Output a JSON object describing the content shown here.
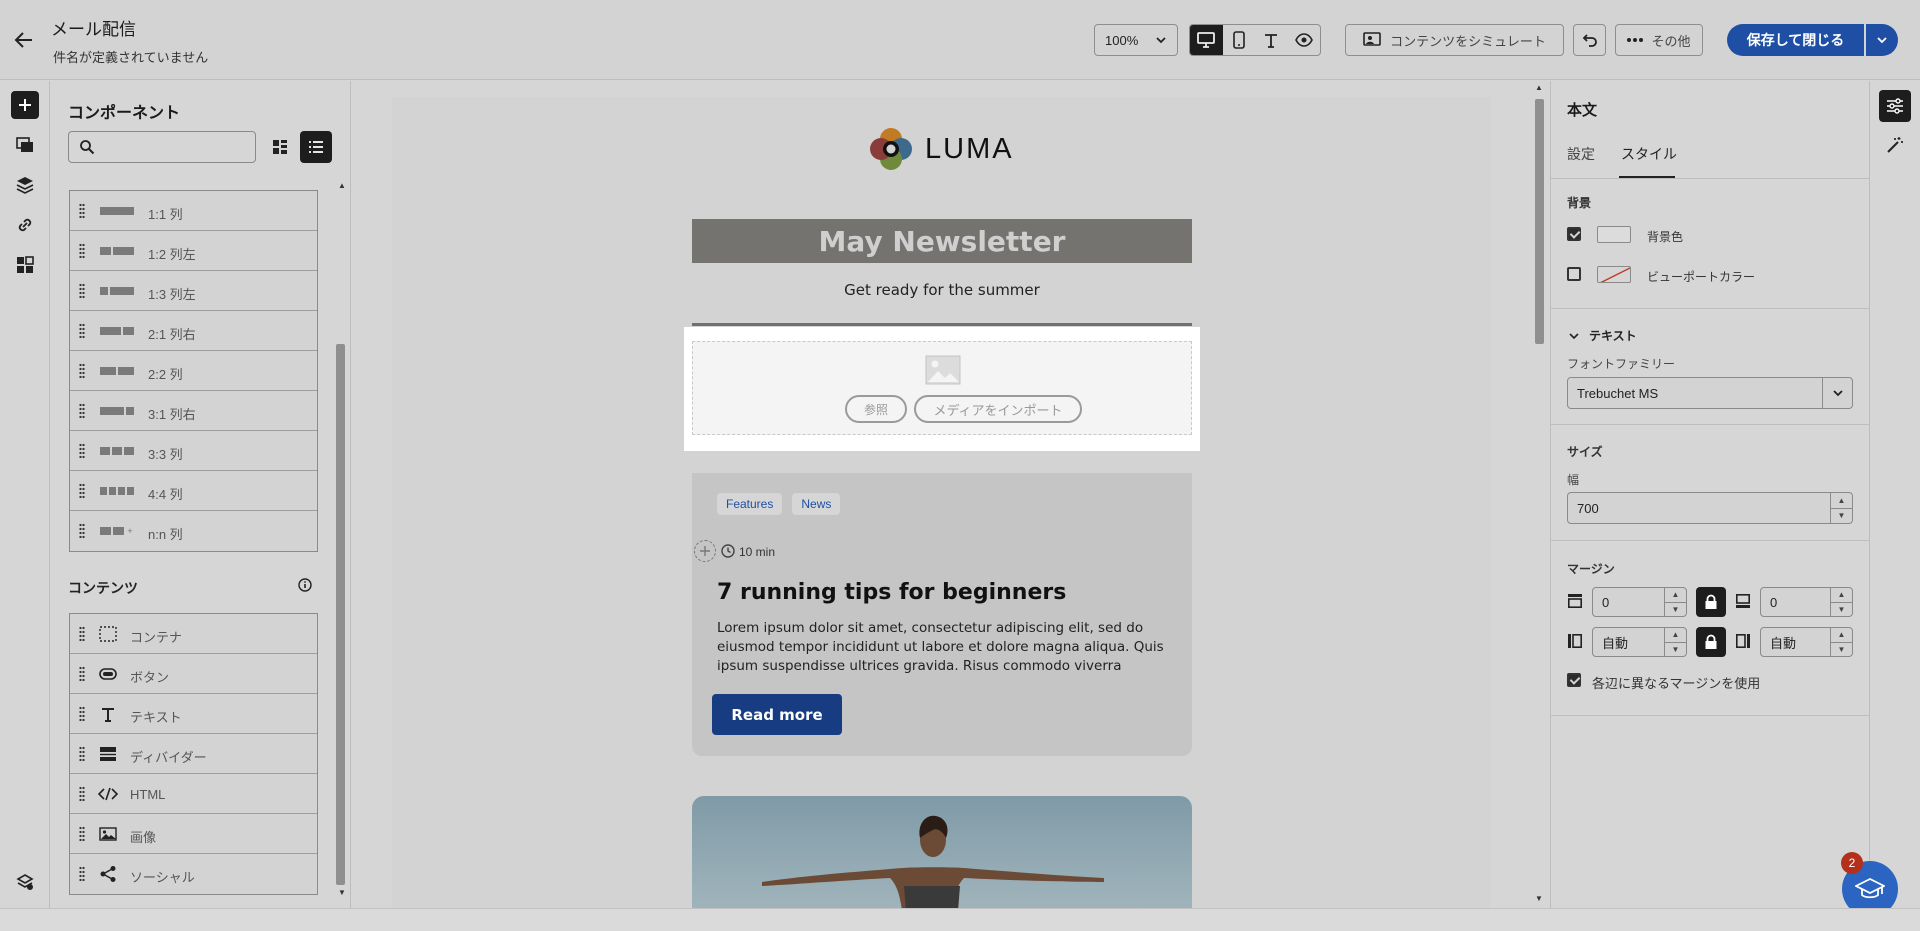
{
  "header": {
    "title": "メール配信",
    "subtitle": "件名が定義されていません",
    "zoom": "100%",
    "simulate_label": "コンテンツをシミュレート",
    "more_label": "その他",
    "save_label": "保存して閉じる"
  },
  "components": {
    "title": "コンポーネント",
    "search_placeholder": "",
    "structures": [
      {
        "label": "1:1 列",
        "cols": [
          1
        ]
      },
      {
        "label": "1:2 列左",
        "cols": [
          1,
          2
        ]
      },
      {
        "label": "1:3 列左",
        "cols": [
          1,
          3
        ]
      },
      {
        "label": "2:1 列右",
        "cols": [
          2,
          1
        ]
      },
      {
        "label": "2:2 列",
        "cols": [
          1,
          1
        ]
      },
      {
        "label": "3:1 列右",
        "cols": [
          3,
          1
        ]
      },
      {
        "label": "3:3 列",
        "cols": [
          1,
          1,
          1
        ]
      },
      {
        "label": "4:4 列",
        "cols": [
          1,
          1,
          1,
          1
        ]
      },
      {
        "label": "n:n 列",
        "cols": [
          1,
          1,
          "+"
        ]
      }
    ],
    "content_title": "コンテンツ",
    "content_items": [
      {
        "label": "コンテナ",
        "icon": "container-icon"
      },
      {
        "label": "ボタン",
        "icon": "button-icon"
      },
      {
        "label": "テキスト",
        "icon": "text-icon"
      },
      {
        "label": "ディバイダー",
        "icon": "divider-icon"
      },
      {
        "label": "HTML",
        "icon": "html-icon"
      },
      {
        "label": "画像",
        "icon": "image-icon"
      },
      {
        "label": "ソーシャル",
        "icon": "social-icon"
      }
    ]
  },
  "email": {
    "brand": "LUMA",
    "banner_title": "May Newsletter",
    "banner_subtitle": "Get ready for the summer",
    "browse_label": "参照",
    "import_label": "メディアをインポート",
    "tags": [
      "Features",
      "News"
    ],
    "read_time": "10 min",
    "article_title": "7 running tips for beginners",
    "article_body": "Lorem ipsum dolor sit amet, consectetur adipiscing elit, sed do eiusmod tempor incididunt ut labore et dolore magna aliqua. Quis ipsum suspendisse ultrices gravida. Risus commodo viverra",
    "cta_label": "Read more"
  },
  "properties": {
    "title": "本文",
    "tab_settings": "設定",
    "tab_style": "スタイル",
    "background_title": "背景",
    "bg_color_label": "背景色",
    "bg_color_checked": true,
    "viewport_color_label": "ビューポートカラー",
    "viewport_color_checked": false,
    "text_title": "テキスト",
    "font_family_label": "フォントファミリー",
    "font_family": "Trebuchet MS",
    "size_title": "サイズ",
    "width_label": "幅",
    "width_value": "700",
    "margin_title": "マージン",
    "margin_top": "0",
    "margin_bottom": "0",
    "margin_left": "自動",
    "margin_right": "自動",
    "different_margins_label": "各辺に異なるマージンを使用",
    "different_margins_checked": true
  },
  "help": {
    "badge_count": "2"
  },
  "colors": {
    "accent": "#1e4fa5",
    "cta": "#173c82",
    "banner_bg": "#757370",
    "selected_block_bg": "#ffffff",
    "card_bg": "#c5c5c5",
    "badge": "#b3301c"
  }
}
